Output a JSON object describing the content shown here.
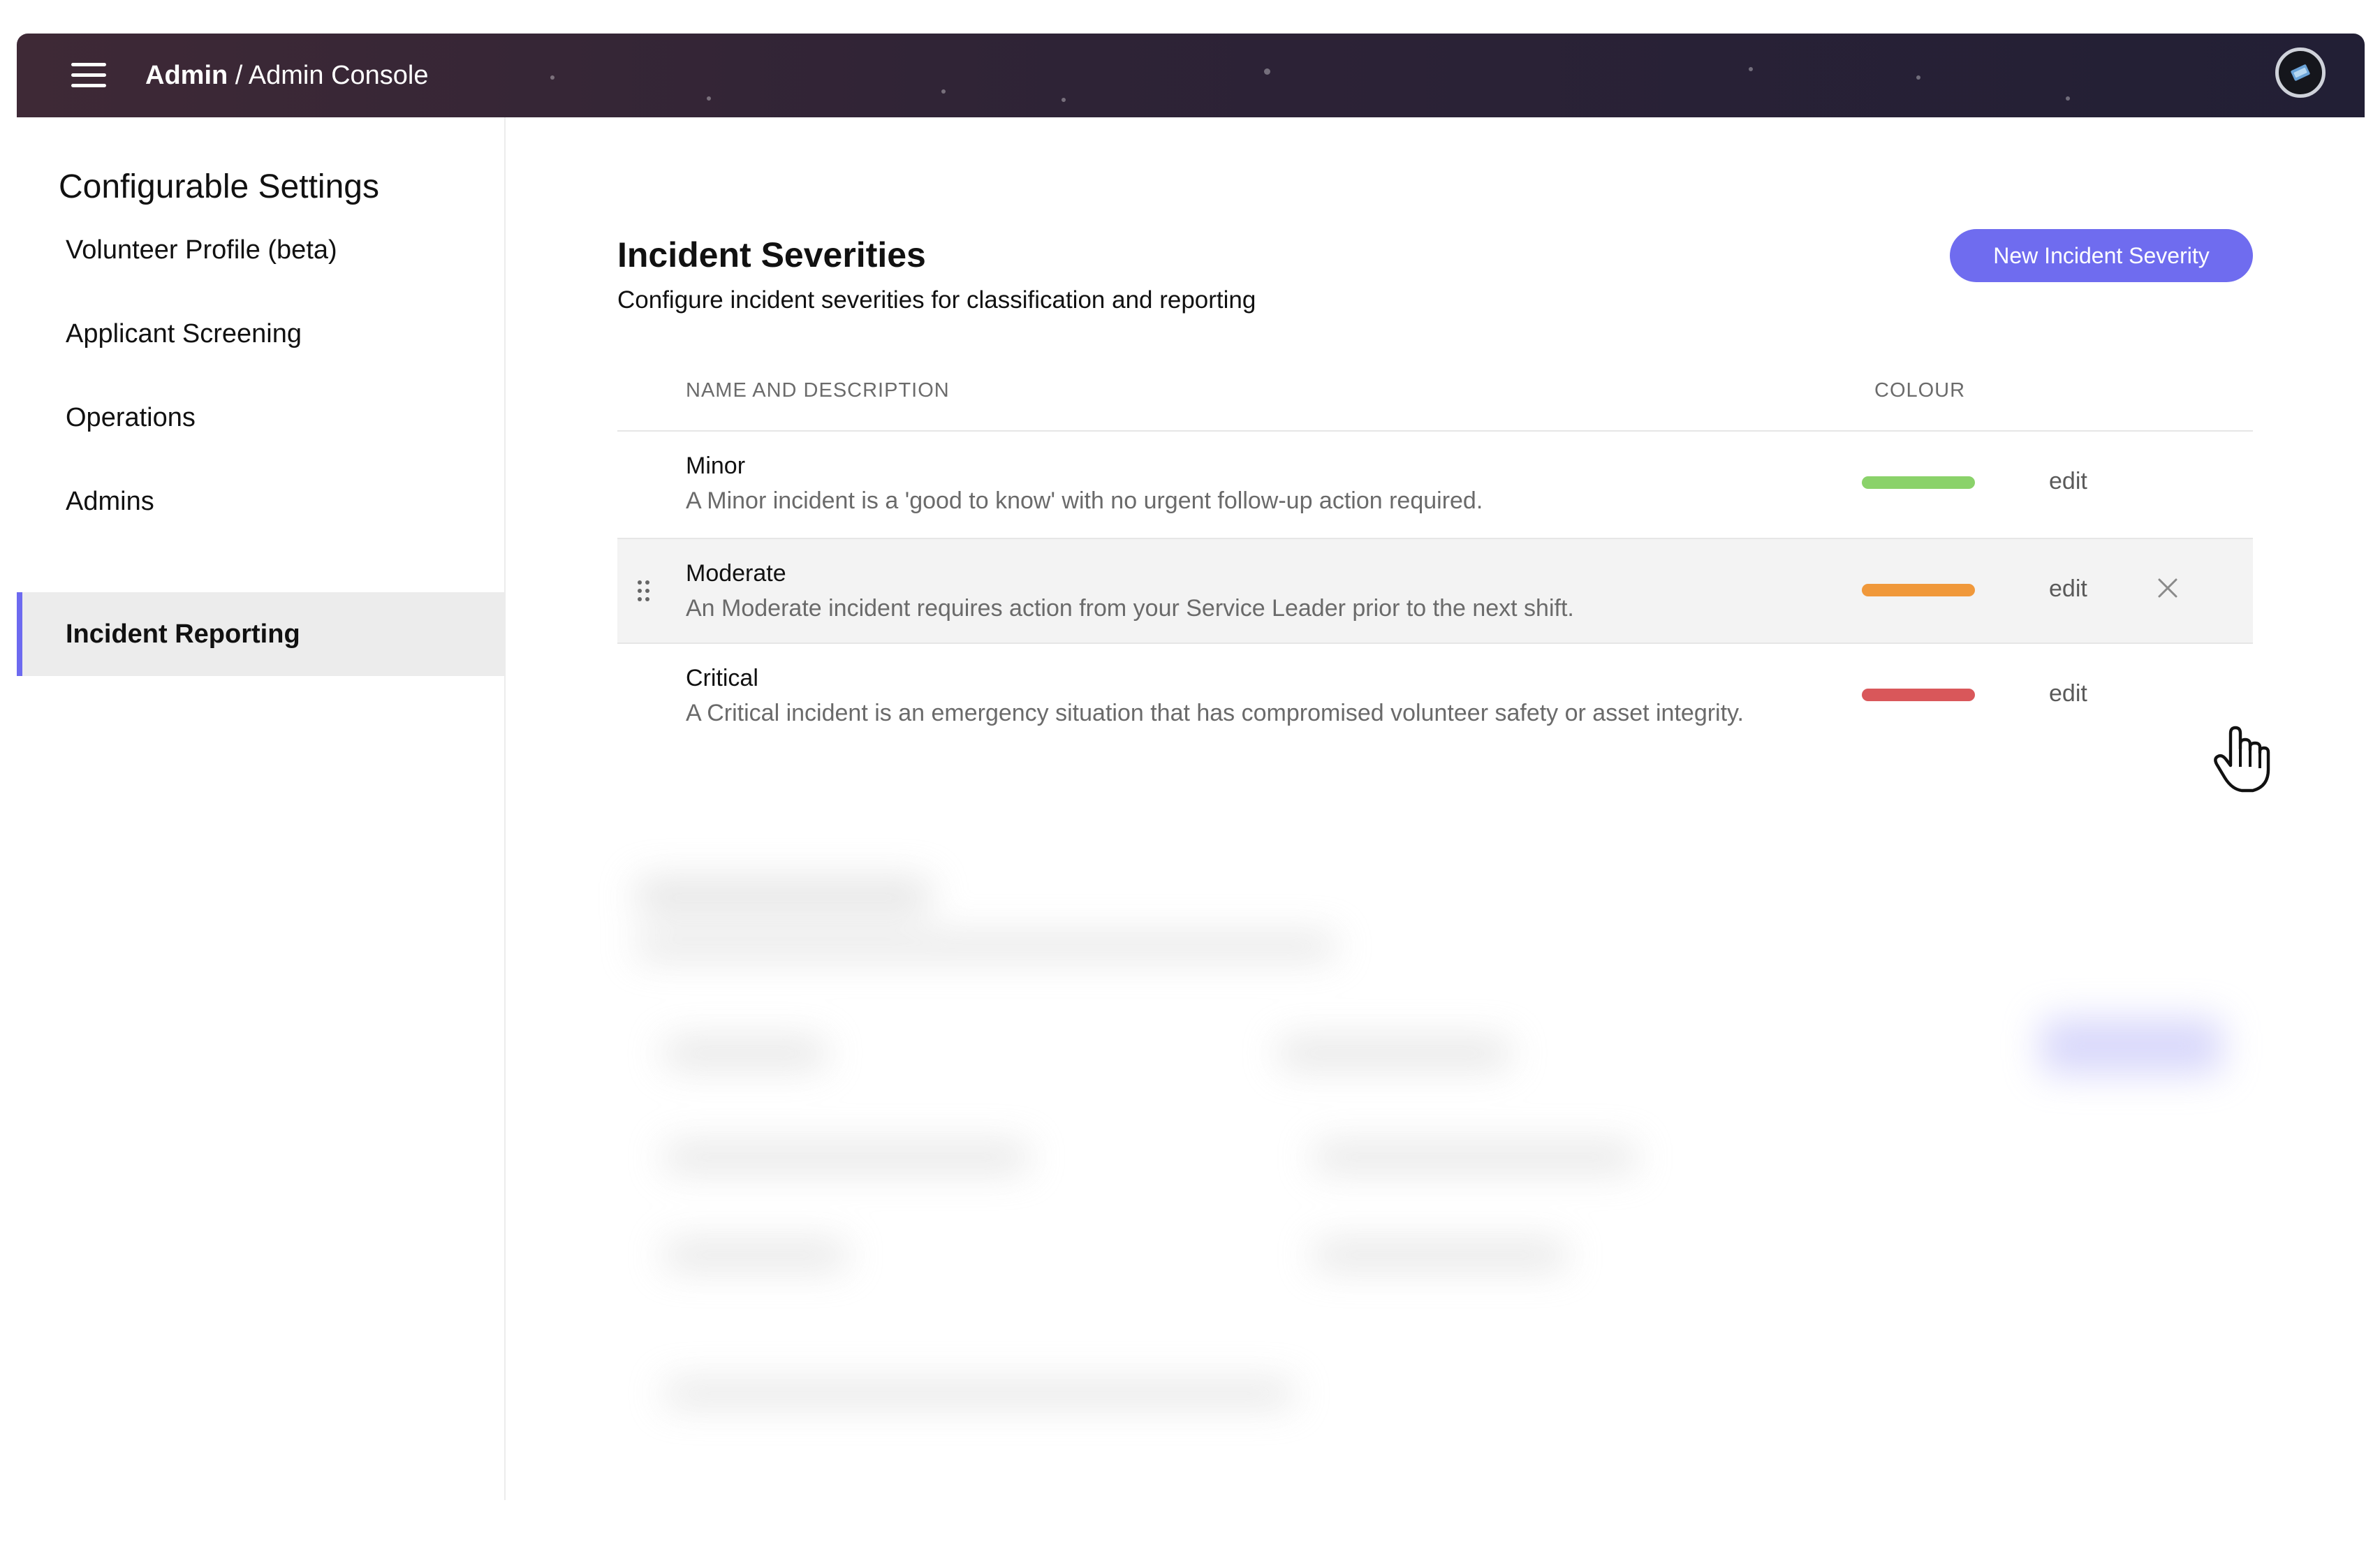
{
  "header": {
    "breadcrumb_root": "Admin",
    "breadcrumb_separator": " / ",
    "breadcrumb_current": "Admin Console"
  },
  "sidebar": {
    "title": "Configurable Settings",
    "items": [
      {
        "label": "Volunteer Profile (beta)",
        "active": false
      },
      {
        "label": "Applicant Screening",
        "active": false
      },
      {
        "label": "Operations",
        "active": false
      },
      {
        "label": "Admins",
        "active": false
      },
      {
        "label": "Incident Reporting",
        "active": true
      }
    ]
  },
  "main": {
    "title": "Incident Severities",
    "subtitle": "Configure incident severities for classification and reporting",
    "new_button_label": "New Incident Severity",
    "columns": {
      "name": "NAME AND DESCRIPTION",
      "colour": "COLOUR"
    },
    "rows": [
      {
        "name": "Minor",
        "description": "A Minor incident is a 'good to know' with no urgent follow-up action required.",
        "colour": "#8ad26a",
        "edit_label": "edit"
      },
      {
        "name": "Moderate",
        "description": "An Moderate incident requires action from your Service Leader prior to the next shift.",
        "colour": "#f0983a",
        "edit_label": "edit"
      },
      {
        "name": "Critical",
        "description": "A Critical incident is an emergency situation that has compromised volunteer safety or asset integrity.",
        "colour": "#d9575a",
        "edit_label": "edit"
      }
    ]
  },
  "colors": {
    "accent": "#6f6cef",
    "topbar": "#2e2336"
  },
  "icons": [
    "menu-icon",
    "avatar-icon",
    "drag-handle-icon",
    "close-icon",
    "hand-cursor-icon"
  ]
}
